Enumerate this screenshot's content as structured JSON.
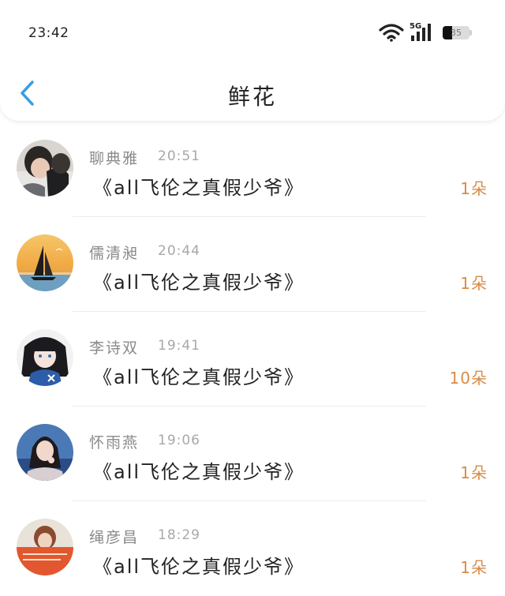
{
  "status_bar": {
    "time": "23:42",
    "network": "5G",
    "battery": "35",
    "battery_level": 0.35
  },
  "header": {
    "title": "鲜花",
    "back_icon": "chevron-left-icon",
    "accent_color": "#3a9ee4"
  },
  "gifts": [
    {
      "name": "聊典雅",
      "time": "20:51",
      "book": "《all飞伦之真假少爷》",
      "count": "1朵"
    },
    {
      "name": "儒清昶",
      "time": "20:44",
      "book": "《all飞伦之真假少爷》",
      "count": "1朵"
    },
    {
      "name": "李诗双",
      "time": "19:41",
      "book": "《all飞伦之真假少爷》",
      "count": "10朵"
    },
    {
      "name": "怀雨燕",
      "time": "19:06",
      "book": "《all飞伦之真假少爷》",
      "count": "1朵"
    },
    {
      "name": "绳彦昌",
      "time": "18:29",
      "book": "《all飞伦之真假少爷》",
      "count": "1朵"
    }
  ],
  "colors": {
    "count": "#d98b45",
    "name": "#8a8a8a",
    "time": "#a8a8a8"
  }
}
